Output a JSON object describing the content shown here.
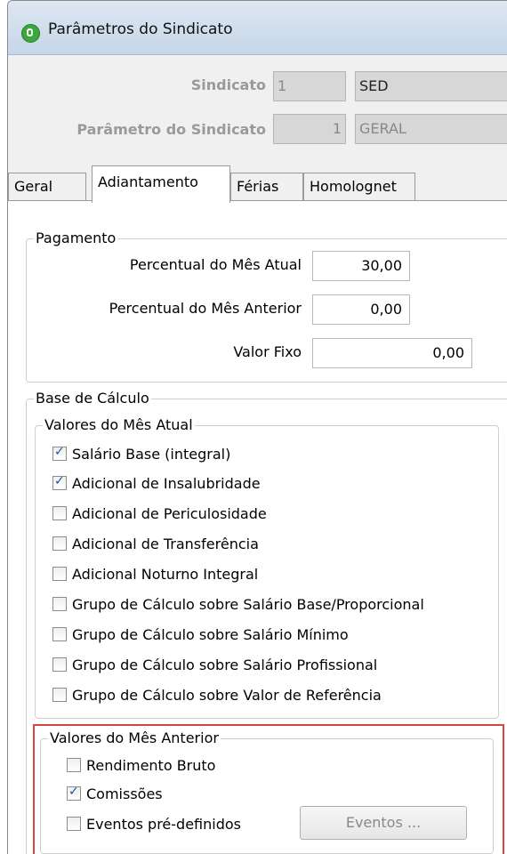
{
  "window": {
    "title": "Parâmetros do Sindicato"
  },
  "header": {
    "sindicato_label": "Sindicato",
    "sindicato_code": "1",
    "sindicato_name": "SED",
    "parametro_label": "Parâmetro do Sindicato",
    "parametro_code": "1",
    "parametro_name": "GERAL"
  },
  "tabs": [
    {
      "label": "Geral"
    },
    {
      "label": "Adiantamento"
    },
    {
      "label": "Férias"
    },
    {
      "label": "Homolognet"
    }
  ],
  "pagamento": {
    "legend": "Pagamento",
    "fields": [
      {
        "label": "Percentual do Mês Atual",
        "value": "30,00"
      },
      {
        "label": "Percentual do Mês Anterior",
        "value": "0,00"
      },
      {
        "label": "Valor Fixo",
        "value": "0,00"
      }
    ]
  },
  "base_calculo": {
    "legend": "Base de Cálculo",
    "mes_atual": {
      "legend": "Valores do Mês Atual",
      "items": [
        {
          "label": "Salário Base (integral)",
          "checked": true
        },
        {
          "label": "Adicional de Insalubridade",
          "checked": true
        },
        {
          "label": "Adicional de Periculosidade",
          "checked": false
        },
        {
          "label": "Adicional de Transferência",
          "checked": false
        },
        {
          "label": "Adicional Noturno Integral",
          "checked": false
        },
        {
          "label": "Grupo de Cálculo sobre Salário Base/Proporcional",
          "checked": false
        },
        {
          "label": "Grupo de Cálculo sobre Salário Mínimo",
          "checked": false
        },
        {
          "label": "Grupo de Cálculo sobre Salário Profissional",
          "checked": false
        },
        {
          "label": "Grupo de Cálculo sobre Valor de Referência",
          "checked": false
        }
      ]
    },
    "mes_anterior": {
      "legend": "Valores do Mês Anterior",
      "items": [
        {
          "label": "Rendimento Bruto",
          "checked": false
        },
        {
          "label": "Comissões",
          "checked": true
        },
        {
          "label": "Eventos pré-definidos",
          "checked": false
        }
      ],
      "eventos_button": "Eventos ..."
    }
  },
  "colors": {
    "highlight_border": "#d64545",
    "check_color": "#1f4fa8"
  }
}
